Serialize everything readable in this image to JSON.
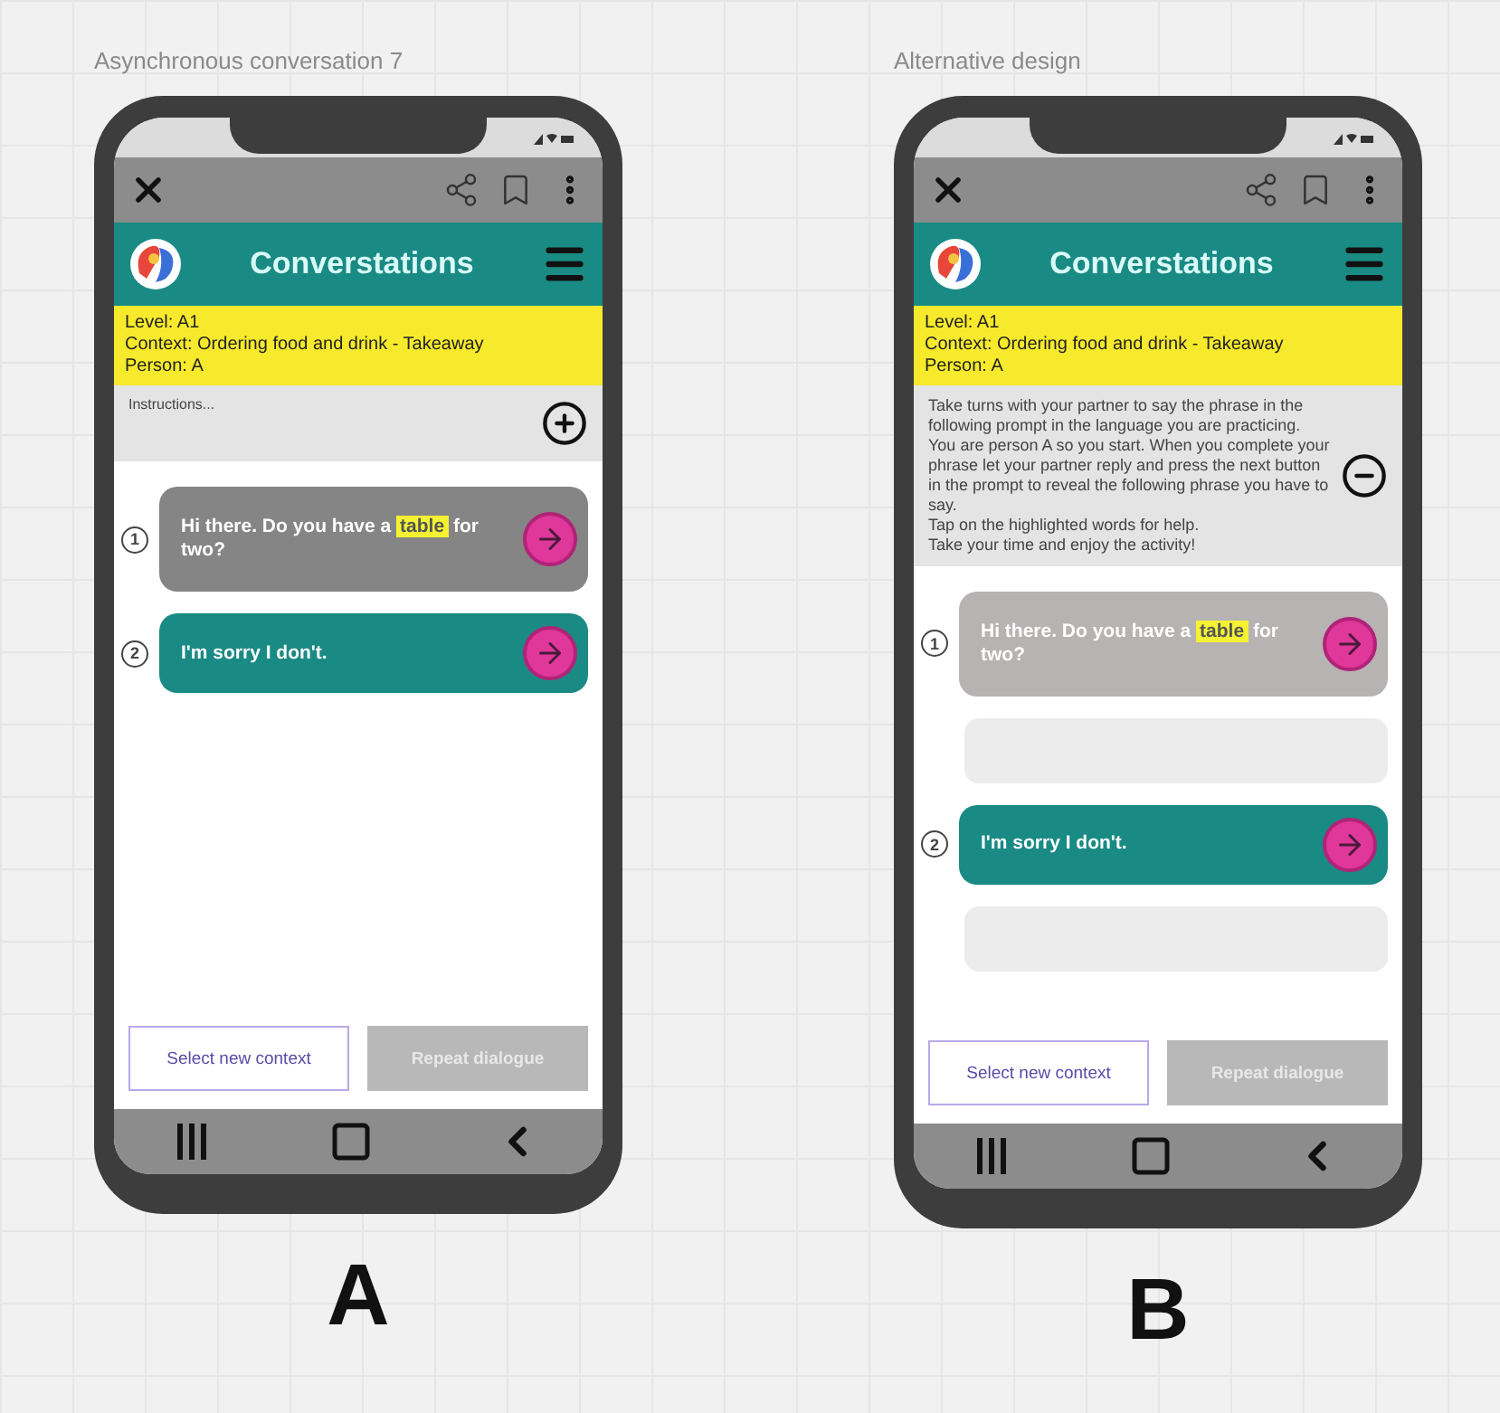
{
  "screens": [
    {
      "caption": "Asynchronous conversation 7",
      "letter": "A",
      "app_title": "Converstations",
      "info": [
        "Level: A1",
        "Context: Ordering food and drink - Takeaway",
        "Person: A"
      ],
      "instructions": {
        "text": "Instructions...",
        "expanded": false
      },
      "messages": [
        {
          "number": "1",
          "kind": "prompt",
          "dimmed": false,
          "answer_field": false,
          "segments": [
            {
              "text": "Hi there. Do you have a ",
              "highlighted": false
            },
            {
              "text": "table",
              "highlighted": true
            },
            {
              "text": " for two?",
              "highlighted": false
            }
          ]
        },
        {
          "number": "2",
          "kind": "reply",
          "answer_field": false,
          "segments": [
            {
              "text": "I'm sorry I don't.",
              "highlighted": false
            }
          ]
        }
      ],
      "buttons": [
        {
          "label": "Select new context",
          "disabled": false
        },
        {
          "label": "Repeat dialogue",
          "disabled": true
        }
      ]
    },
    {
      "caption": "Alternative design",
      "letter": "B",
      "app_title": "Converstations",
      "info": [
        "Level: A1",
        "Context: Ordering food and drink - Takeaway",
        "Person: A"
      ],
      "instructions": {
        "text": "Take turns with your partner to say the phrase in the following prompt in the language you are practicing. You are person A so you start. When you complete your phrase let your partner reply and press the next button in the prompt to reveal the following phrase you have to say.\nTap on the highlighted words for help.\nTake your time and enjoy the activity!",
        "expanded": true
      },
      "messages": [
        {
          "number": "1",
          "kind": "prompt",
          "dimmed": true,
          "answer_field": true,
          "segments": [
            {
              "text": "Hi there. Do you have a ",
              "highlighted": false
            },
            {
              "text": "table",
              "highlighted": true
            },
            {
              "text": " for two?",
              "highlighted": false
            }
          ]
        },
        {
          "number": "2",
          "kind": "reply",
          "answer_field": true,
          "segments": [
            {
              "text": "I'm sorry I don't.",
              "highlighted": false
            }
          ]
        }
      ],
      "buttons": [
        {
          "label": "Select new context",
          "disabled": false
        },
        {
          "label": "Repeat dialogue",
          "disabled": true
        }
      ]
    }
  ]
}
